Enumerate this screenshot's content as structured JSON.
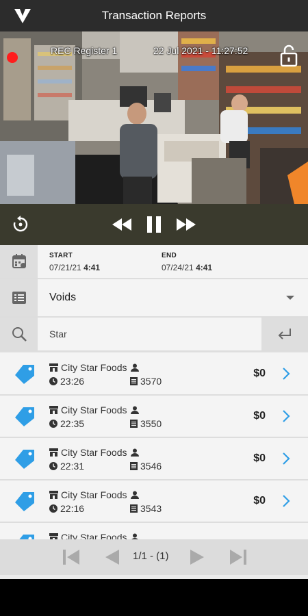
{
  "header": {
    "title": "Transaction Reports",
    "logo_icon": "logo-v-icon"
  },
  "video": {
    "overlay_label": "REC Register 1",
    "overlay_timestamp": "22 Jul 2021 - 11:27:52",
    "rec_color": "#ff1d1d",
    "lock_icon": "lock-open-icon"
  },
  "controls": {
    "replay_icon": "replay-icon",
    "rewind_icon": "rewind-icon",
    "pause_icon": "pause-icon",
    "forward_icon": "fast-forward-icon"
  },
  "filters": {
    "start_label": "START",
    "start_date": "07/21/21",
    "start_time": "4:41",
    "end_label": "END",
    "end_date": "07/24/21",
    "end_time": "4:41",
    "report_type": "Voids",
    "search_value": "Star"
  },
  "transactions": [
    {
      "store": "City Star Foods",
      "time": "23:26",
      "number": "3570",
      "amount": "$0"
    },
    {
      "store": "City Star Foods",
      "time": "22:35",
      "number": "3550",
      "amount": "$0"
    },
    {
      "store": "City Star Foods",
      "time": "22:31",
      "number": "3546",
      "amount": "$0"
    },
    {
      "store": "City Star Foods",
      "time": "22:16",
      "number": "3543",
      "amount": "$0"
    },
    {
      "store": "City Star Foods",
      "time": "",
      "number": "",
      "amount": ""
    }
  ],
  "pager": {
    "text": "1/1 - (1)"
  },
  "colors": {
    "accent": "#2f9ee6",
    "controls_bg": "#3a3a2d",
    "topbar_bg": "#2c2c2c"
  }
}
